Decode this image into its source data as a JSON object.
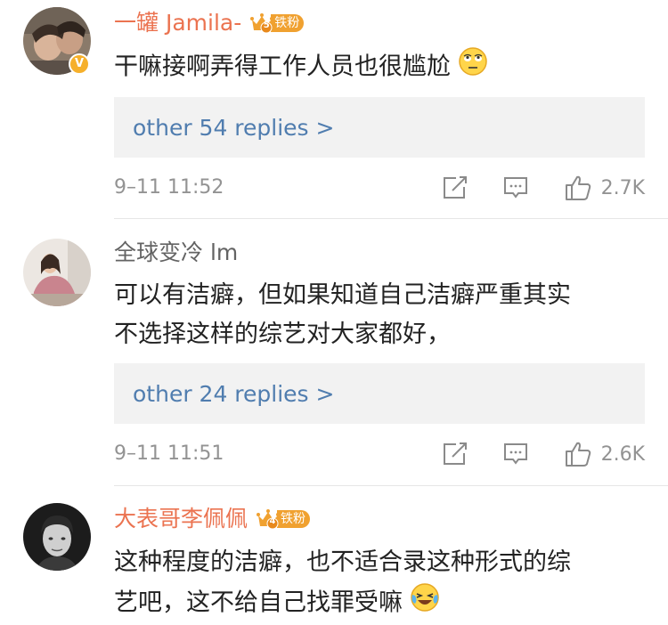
{
  "comments": [
    {
      "username": "一罐 Jamila-",
      "fan_badge": {
        "level": "5",
        "label": "铁粉"
      },
      "verified_badge": "V",
      "text_lines": [
        "干嘛接啊弄得工作人员也很尴尬"
      ],
      "emoji": "eye-roll-emoji",
      "replies_label": "other 54 replies >",
      "time": "9–11 11:52",
      "likes": "2.7K"
    },
    {
      "username": "全球变冷 lm",
      "text_lines": [
        "可以有洁癖，但如果知道自己洁癖严重其实",
        "不选择这样的综艺对大家都好，"
      ],
      "replies_label": "other 24 replies >",
      "time": "9–11 11:51",
      "likes": "2.6K"
    },
    {
      "username": "大表哥李佩佩",
      "fan_badge": {
        "level": "4",
        "label": "铁粉"
      },
      "text_lines": [
        "这种程度的洁癖，也不适合录这种形式的综",
        "艺吧，这不给自己找罪受嘛"
      ],
      "emoji": "laugh-cry-emoji"
    }
  ],
  "colors": {
    "username_accent": "#eb7350",
    "reply_link": "#507daf",
    "meta_gray": "#939393"
  }
}
